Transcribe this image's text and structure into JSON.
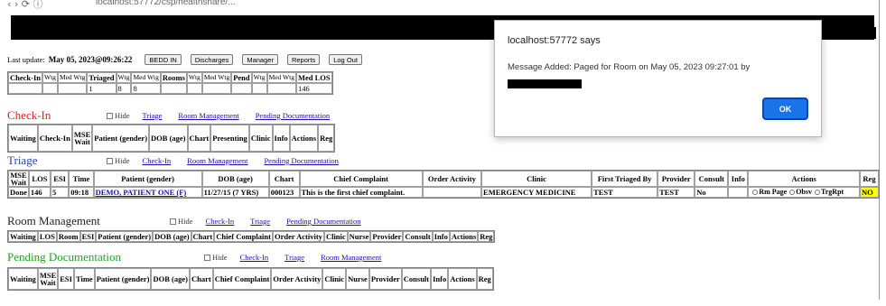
{
  "browser": {
    "url": "localhost:57772/csp/healthshare/...",
    "nav_glyphs": "‹   ›   ⟳    ⓘ"
  },
  "header": {
    "last_update_label": "Last update:",
    "last_update_value": "May 05, 2023@09:26:22",
    "buttons": [
      "BEDD IN",
      "Discharges",
      "Manager",
      "Reports",
      "Log Out"
    ]
  },
  "stats": {
    "headers": [
      "Check-In",
      "Wtg",
      "Med Wtg",
      "Triaged",
      "Wtg",
      "Med Wtg",
      "Rooms",
      "Wtg",
      "Med Wtg",
      "Pend",
      "Wtg",
      "Med Wtg",
      "Med LOS"
    ],
    "values": [
      "",
      "",
      "",
      "1",
      "8",
      "8",
      "",
      "",
      "",
      "",
      "",
      "",
      "146"
    ]
  },
  "sections": {
    "checkin": {
      "title": "Check-In",
      "hide_label": "Hide",
      "links": [
        "Triage",
        "Room Management",
        "Pending Documentation"
      ],
      "columns": [
        "Waiting",
        "Check-In",
        "MSE Wait",
        "Patient (gender)",
        "DOB (age)",
        "Chart",
        "Presenting",
        "Clinic",
        "Info",
        "Actions",
        "Reg"
      ]
    },
    "triage": {
      "title": "Triage",
      "hide_label": "Hide",
      "links": [
        "Check-In",
        "Room Management",
        "Pending Documentation"
      ],
      "columns": [
        "MSE Wait",
        "LOS",
        "ESI",
        "Time",
        "Patient (gender)",
        "DOB (age)",
        "Chart",
        "Chief Complaint",
        "Order Activity",
        "Clinic",
        "First Triaged By",
        "Provider",
        "Consult",
        "Info",
        "Actions",
        "Reg"
      ],
      "row": {
        "mse_wait": "Done",
        "los": "146",
        "esi": "5",
        "time": "09:18",
        "patient": "DEMO, PATIENT ONE (F)",
        "dob": "11/27/15 (7 YRS)",
        "chart": "000123",
        "complaint": "This is the first chief complaint.",
        "order_activity": "",
        "clinic": "EMERGENCY MEDICINE",
        "first_triaged_by": "TEST",
        "provider": "TEST",
        "consult": "No",
        "info": "",
        "actions": [
          "Rm Page",
          "Obsv",
          "TrgRpt"
        ],
        "reg": "NO"
      }
    },
    "room": {
      "title": "Room Management",
      "hide_label": "Hide",
      "links": [
        "Check-In",
        "Triage",
        "Pending Documentation"
      ],
      "columns": [
        "Waiting",
        "LOS",
        "Room",
        "ESI",
        "Patient (gender)",
        "DOB (age)",
        "Chart",
        "Chief Complaint",
        "Order Activity",
        "Clinic",
        "Nurse",
        "Provider",
        "Consult",
        "Info",
        "Actions",
        "Reg"
      ]
    },
    "pending": {
      "title": "Pending Documentation",
      "hide_label": "Hide",
      "links": [
        "Check-In",
        "Triage",
        "Room Management"
      ],
      "columns": [
        "Waiting",
        "MSE Wait",
        "ESI",
        "Time",
        "Patient (gender)",
        "DOB (age)",
        "Chart",
        "Chief Complaint",
        "Order Activity",
        "Clinic",
        "Nurse",
        "Provider",
        "Consult",
        "Info",
        "Actions",
        "Reg"
      ]
    }
  },
  "dialog": {
    "title": "localhost:57772 says",
    "message": "Message Added: Paged for Room on May 05, 2023 09:27:01 by",
    "ok_label": "OK"
  },
  "colors": {
    "checkin": "#e02020",
    "triage": "#2a3bc9",
    "room": "#222222",
    "pending": "#1fa51f",
    "reg_no_bg": "#ffff00",
    "ok_button": "#1a73e8"
  }
}
